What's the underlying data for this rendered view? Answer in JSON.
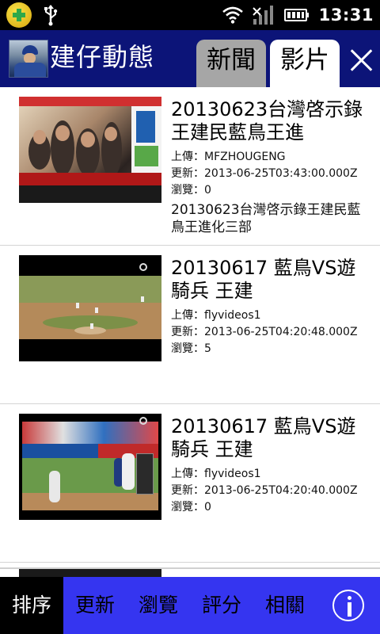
{
  "status_bar": {
    "time": "13:31",
    "icons": [
      "app-notification-icon",
      "usb-icon",
      "wifi-icon",
      "signal-icon",
      "battery-icon"
    ]
  },
  "header": {
    "title": "建仔動態",
    "tabs": [
      {
        "label": "新聞",
        "selected": false
      },
      {
        "label": "影片",
        "selected": true
      }
    ],
    "close_icon": "close-icon"
  },
  "videos": [
    {
      "title": "20130623台灣啓示錄 王建民藍鳥王進",
      "uploader": "上傳：MFZHOUGENG",
      "updated": "更新：2013-06-25T03:43:00.000Z",
      "views": "瀏覽：0",
      "description": "20130623台灣啓示錄王建民藍鳥王進化三部"
    },
    {
      "title": "20130617 藍鳥VS遊騎兵 王建",
      "uploader": "上傳：flyvideos1",
      "updated": "更新：2013-06-25T04:20:48.000Z",
      "views": "瀏覽：5",
      "description": ""
    },
    {
      "title": "20130617 藍鳥VS遊騎兵 王建",
      "uploader": "上傳：flyvideos1",
      "updated": "更新：2013-06-25T04:20:40.000Z",
      "views": "瀏覽：0",
      "description": ""
    }
  ],
  "bottom_bar": {
    "sort_label": "排序",
    "options": [
      "更新",
      "瀏覽",
      "評分",
      "相關"
    ],
    "info_icon": "info-icon",
    "colors": {
      "bar": "#3535f0",
      "sort_bg": "#000000"
    }
  },
  "colors": {
    "header": "#0c1478",
    "tab_unselected": "#a6a6a6",
    "tab_selected": "#ffffff"
  }
}
